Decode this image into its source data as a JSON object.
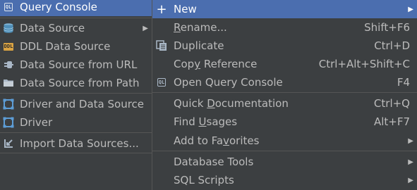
{
  "colors": {
    "menu_bg": "#3c3f41",
    "selection_bg": "#4b6eaf",
    "text": "#bbbbbb",
    "separator": "#555555"
  },
  "submenu": {
    "items": [
      {
        "label": "Query Console",
        "icon": "query-console-icon",
        "selected": true
      },
      {
        "label": "Data Source",
        "icon": "database-icon",
        "arrow": "▶"
      },
      {
        "label": "DDL Data Source",
        "icon": "ddl-icon"
      },
      {
        "label": "Data Source from URL",
        "icon": "plug-icon"
      },
      {
        "label": "Data Source from Path",
        "icon": "folder-icon"
      },
      {
        "label": "Driver and Data Source",
        "icon": "driver-icon"
      },
      {
        "label": "Driver",
        "icon": "driver-icon"
      },
      {
        "label": "Import Data Sources...",
        "icon": "import-icon"
      }
    ],
    "ql_text": "QL",
    "ddl_text": "DDL"
  },
  "context_menu": {
    "items": [
      {
        "label": "New",
        "icon": "plus-icon",
        "arrow": "▶",
        "selected": true
      },
      {
        "label_pre": "",
        "label_ul": "R",
        "label_post": "ename...",
        "shortcut": "Shift+F6"
      },
      {
        "label": "Duplicate",
        "icon": "duplicate-icon",
        "shortcut": "Ctrl+D"
      },
      {
        "label_pre": "Cop",
        "label_ul": "y",
        "label_post": " Reference",
        "shortcut": "Ctrl+Alt+Shift+C"
      },
      {
        "label": "Open Query Console",
        "icon": "query-console-icon",
        "shortcut": "F4"
      },
      {
        "label_pre": "Quick ",
        "label_ul": "D",
        "label_post": "ocumentation",
        "shortcut": "Ctrl+Q"
      },
      {
        "label_pre": "Find ",
        "label_ul": "U",
        "label_post": "sages",
        "shortcut": "Alt+F7"
      },
      {
        "label_pre": "Add to Fa",
        "label_ul": "v",
        "label_post": "orites",
        "arrow": "▶"
      },
      {
        "label": "Database Tools",
        "arrow": "▶"
      },
      {
        "label": "SQL Scripts",
        "arrow": "▶"
      }
    ]
  }
}
